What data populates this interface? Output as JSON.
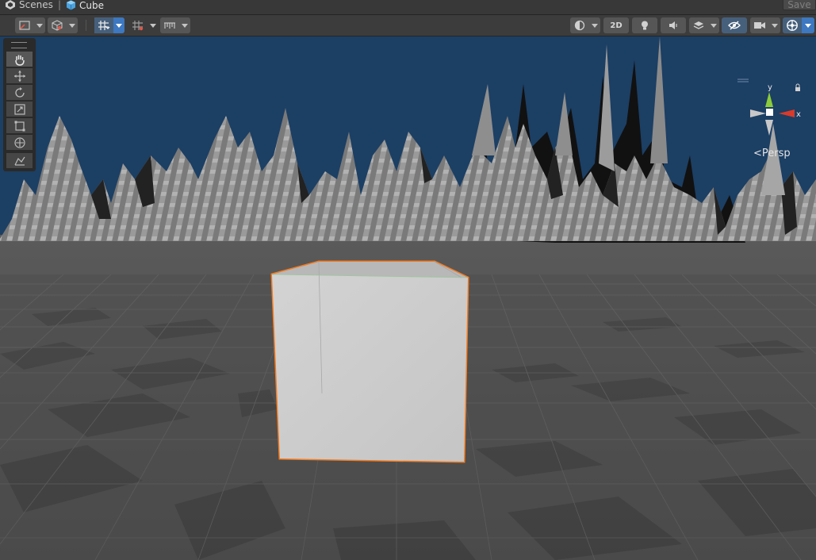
{
  "breadcrumb": {
    "scenes_label": "Scenes",
    "separator": "|",
    "object_label": "Cube",
    "save_label": "Save"
  },
  "toolbar": {
    "left_items": [
      {
        "name": "draw-mode-icon",
        "has_dropdown": true
      },
      {
        "name": "shading-cube-icon",
        "has_dropdown": true
      },
      {
        "name": "grid-snapping-icon",
        "has_dropdown": true,
        "active": true
      },
      {
        "name": "increment-snap-icon",
        "has_dropdown": true
      },
      {
        "name": "ruler-icon",
        "has_dropdown": true
      }
    ],
    "right_items": [
      {
        "name": "shading-sphere-icon",
        "has_dropdown": true
      },
      {
        "name": "2d-toggle",
        "label": "2D"
      },
      {
        "name": "lighting-icon"
      },
      {
        "name": "audio-icon"
      },
      {
        "name": "effects-layers-icon",
        "has_dropdown": true
      },
      {
        "name": "hidden-objects-icon",
        "active": true
      },
      {
        "name": "camera-icon",
        "has_dropdown": true
      },
      {
        "name": "gizmos-icon",
        "has_dropdown": true,
        "active": true
      }
    ]
  },
  "tools": [
    {
      "name": "hand-tool-icon",
      "active": true
    },
    {
      "name": "move-tool-icon"
    },
    {
      "name": "rotate-tool-icon"
    },
    {
      "name": "scale-tool-icon"
    },
    {
      "name": "rect-tool-icon"
    },
    {
      "name": "transform-tool-icon"
    },
    {
      "name": "custom-tool-icon"
    }
  ],
  "gizmo": {
    "y_label": "y",
    "x_label": "x",
    "projection_label": "Persp"
  },
  "colors": {
    "sky": "#1c3f64",
    "ground": "#4a4a4a",
    "selection_outline": "#f47b20",
    "gizmo_y": "#8ccc3a",
    "gizmo_x": "#d83a2c"
  }
}
